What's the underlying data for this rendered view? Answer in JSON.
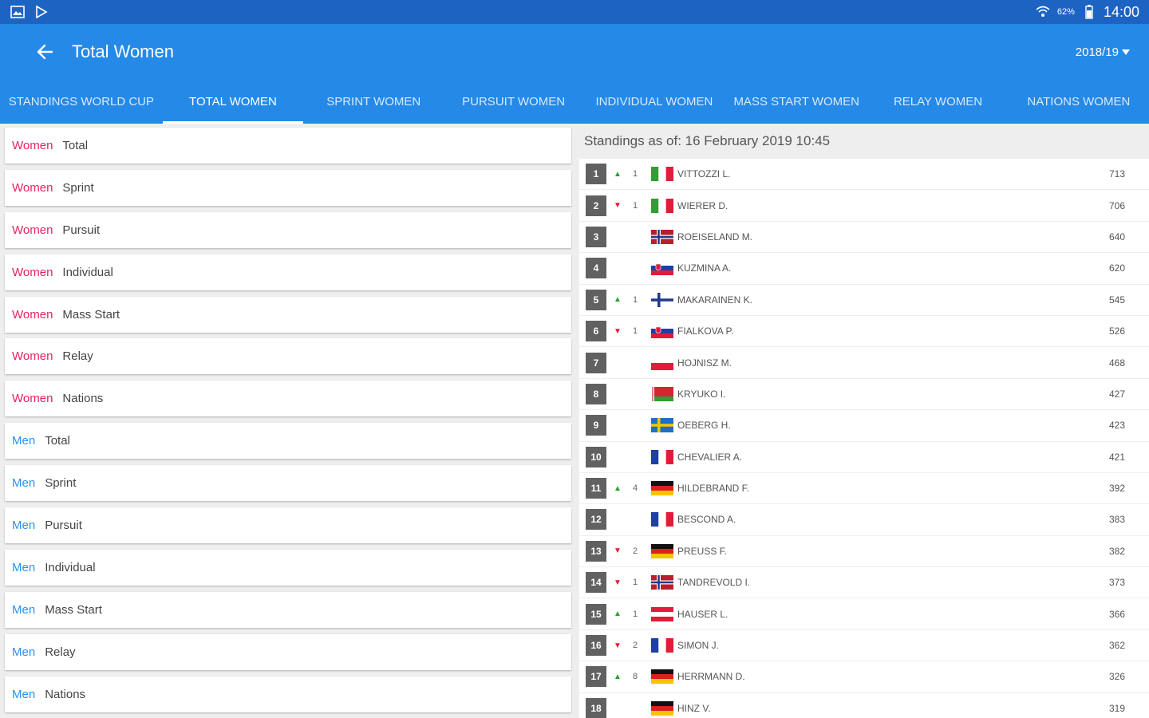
{
  "status": {
    "time": "14:00",
    "battery": "62%"
  },
  "appbar": {
    "title": "Total Women",
    "season": "2018/19"
  },
  "tabs": [
    {
      "label": "STANDINGS WORLD CUP"
    },
    {
      "label": "TOTAL WOMEN",
      "active": true
    },
    {
      "label": "SPRINT WOMEN"
    },
    {
      "label": "PURSUIT WOMEN"
    },
    {
      "label": "INDIVIDUAL WOMEN"
    },
    {
      "label": "MASS START WOMEN"
    },
    {
      "label": "RELAY WOMEN"
    },
    {
      "label": "NATIONS WOMEN"
    }
  ],
  "categories": [
    {
      "gender": "Women",
      "discipline": "Total"
    },
    {
      "gender": "Women",
      "discipline": "Sprint"
    },
    {
      "gender": "Women",
      "discipline": "Pursuit"
    },
    {
      "gender": "Women",
      "discipline": "Individual"
    },
    {
      "gender": "Women",
      "discipline": "Mass Start"
    },
    {
      "gender": "Women",
      "discipline": "Relay"
    },
    {
      "gender": "Women",
      "discipline": "Nations"
    },
    {
      "gender": "Men",
      "discipline": "Total"
    },
    {
      "gender": "Men",
      "discipline": "Sprint"
    },
    {
      "gender": "Men",
      "discipline": "Pursuit"
    },
    {
      "gender": "Men",
      "discipline": "Individual"
    },
    {
      "gender": "Men",
      "discipline": "Mass Start"
    },
    {
      "gender": "Men",
      "discipline": "Relay"
    },
    {
      "gender": "Men",
      "discipline": "Nations"
    }
  ],
  "standings": {
    "as_of": "Standings as of: 16 February 2019 10:45",
    "rows": [
      {
        "rank": "1",
        "trend": "up",
        "move": "1",
        "flag": "ITA",
        "name": "VITTOZZI L.",
        "points": "713"
      },
      {
        "rank": "2",
        "trend": "down",
        "move": "1",
        "flag": "ITA",
        "name": "WIERER D.",
        "points": "706"
      },
      {
        "rank": "3",
        "trend": "",
        "move": "",
        "flag": "NOR",
        "name": "ROEISELAND M.",
        "points": "640"
      },
      {
        "rank": "4",
        "trend": "",
        "move": "",
        "flag": "SVK",
        "name": "KUZMINA A.",
        "points": "620"
      },
      {
        "rank": "5",
        "trend": "up",
        "move": "1",
        "flag": "FIN",
        "name": "MAKARAINEN K.",
        "points": "545"
      },
      {
        "rank": "6",
        "trend": "down",
        "move": "1",
        "flag": "SVK",
        "name": "FIALKOVA P.",
        "points": "526"
      },
      {
        "rank": "7",
        "trend": "",
        "move": "",
        "flag": "POL",
        "name": "HOJNISZ M.",
        "points": "468"
      },
      {
        "rank": "8",
        "trend": "",
        "move": "",
        "flag": "BLR",
        "name": "KRYUKO I.",
        "points": "427"
      },
      {
        "rank": "9",
        "trend": "",
        "move": "",
        "flag": "SWE",
        "name": "OEBERG H.",
        "points": "423"
      },
      {
        "rank": "10",
        "trend": "",
        "move": "",
        "flag": "FRA",
        "name": "CHEVALIER A.",
        "points": "421"
      },
      {
        "rank": "11",
        "trend": "up",
        "move": "4",
        "flag": "GER",
        "name": "HILDEBRAND F.",
        "points": "392"
      },
      {
        "rank": "12",
        "trend": "",
        "move": "",
        "flag": "FRA",
        "name": "BESCOND A.",
        "points": "383"
      },
      {
        "rank": "13",
        "trend": "down",
        "move": "2",
        "flag": "GER",
        "name": "PREUSS F.",
        "points": "382"
      },
      {
        "rank": "14",
        "trend": "down",
        "move": "1",
        "flag": "NOR",
        "name": "TANDREVOLD I.",
        "points": "373"
      },
      {
        "rank": "15",
        "trend": "up",
        "move": "1",
        "flag": "AUT",
        "name": "HAUSER L.",
        "points": "366"
      },
      {
        "rank": "16",
        "trend": "down",
        "move": "2",
        "flag": "FRA",
        "name": "SIMON J.",
        "points": "362"
      },
      {
        "rank": "17",
        "trend": "up",
        "move": "8",
        "flag": "GER",
        "name": "HERRMANN D.",
        "points": "326"
      },
      {
        "rank": "18",
        "trend": "",
        "move": "",
        "flag": "GER",
        "name": "HINZ V.",
        "points": "319"
      }
    ]
  },
  "colors": {
    "header": "#2589e8",
    "statusbar": "#1d64c2",
    "women": "#e5245e",
    "men": "#2a8ff5",
    "rank_badge": "#616161",
    "up": "#2e9e35",
    "down": "#e01c3a"
  }
}
